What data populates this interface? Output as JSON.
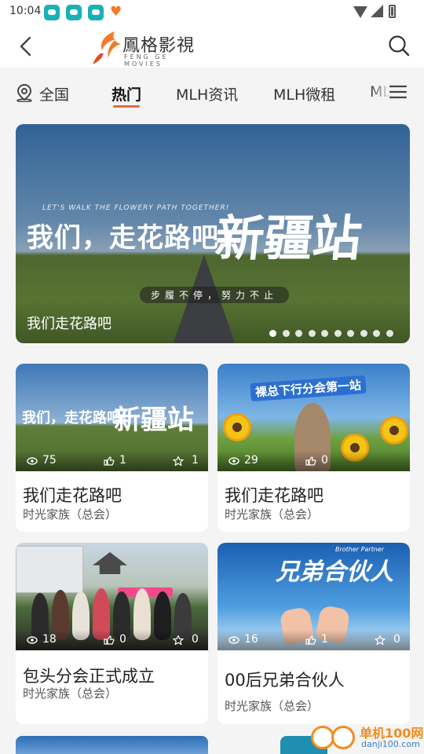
{
  "status_bar": {
    "time": "10:04"
  },
  "header": {
    "logo_title": "鳳格影視",
    "logo_subtitle": "FENG GE MOVIES",
    "back_icon": "chevron-left-icon",
    "search_icon": "search-icon"
  },
  "tabs": {
    "location": "全国",
    "items": [
      "热门",
      "MLH资讯",
      "MLH微租",
      "ML"
    ],
    "active": "热门",
    "menu_icon": "menu-icon"
  },
  "banner": {
    "overlay_subtitle": "LET'S WALK THE FLOWERY PATH TOGETHER!",
    "overlay_main": "我们，走花路吧！",
    "overlay_big": "新疆站",
    "overlay_slogan": "步履不停，努力不止",
    "caption": "我们走花路吧",
    "page_count": 10,
    "active_page": 1
  },
  "cards": [
    {
      "thumb_text_main": "我们，走花路吧！",
      "thumb_text_big": "新疆站",
      "views": "75",
      "likes": "1",
      "favorites": "1",
      "title": "我们走花路吧",
      "subtitle": "时光家族（总会）"
    },
    {
      "thumb_text_main": "裸总下行分会第一站",
      "views": "29",
      "likes": "0",
      "title": "我们走花路吧",
      "subtitle": "时光家族（总会）"
    },
    {
      "views": "18",
      "likes": "0",
      "favorites": "0",
      "title": "包头分会正式成立",
      "subtitle": "时光家族（总会）"
    },
    {
      "thumb_text_main": "兄弟合伙人",
      "thumb_text_sub": "Brother Partner",
      "views": "16",
      "likes": "1",
      "favorites": "0",
      "title": "00后兄弟合伙人",
      "subtitle": "时光家族（总会）"
    }
  ],
  "watermark": {
    "text": "单机100网",
    "url": "danji100.com"
  },
  "colors": {
    "accent": "#e06c3a",
    "background": "#f4f4f4",
    "watermark": "#f28c1e"
  }
}
